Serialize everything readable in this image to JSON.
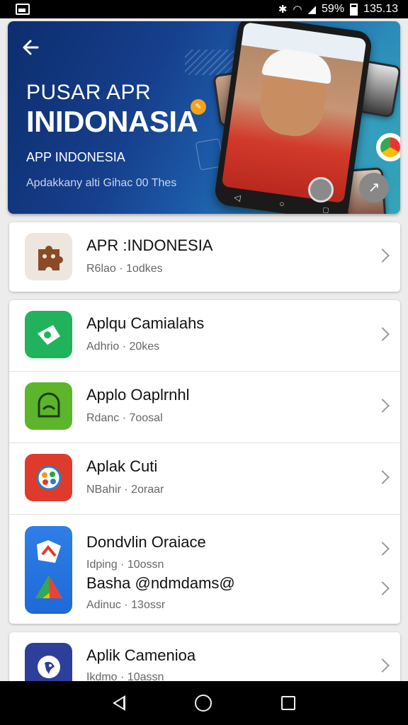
{
  "status_bar": {
    "battery": "59%",
    "time": "135.13"
  },
  "hero": {
    "title_line1": "PUSAR APR",
    "title_line2": "INIDONASIA",
    "subtitle": "APP INDONESIA",
    "caption": "Apdakkany alti Gihac 00 Thes"
  },
  "list": [
    {
      "title": "APR :INDONESIA",
      "subtitle": "R6lao · 1odkes",
      "icon": "puzzle-icon",
      "color": "#e8e2da"
    },
    {
      "title": "Aplqu Camialahs",
      "subtitle": "Adhrio · 20kes",
      "icon": "camera-app-icon",
      "color": "#22b35a"
    },
    {
      "title": "Applo Oaplrnhl",
      "subtitle": "Rdanc · 7oosal",
      "icon": "creature-app-icon",
      "color": "#59b52a"
    },
    {
      "title": "Aplak Cuti",
      "subtitle": "NBahir · 2oraar",
      "icon": "flower-app-icon",
      "color": "#e03a2d"
    },
    {
      "title": "Dondvlin Oraiace",
      "subtitle": "Idping · 10ossn",
      "icon": "maps-icon",
      "color": "#2f7ee6"
    },
    {
      "title": "Basha @ndmdams@",
      "subtitle": "Adinuc · 13ossr",
      "icon": "drive-icon",
      "color": "#1e6ad8"
    },
    {
      "title": "Aplik Camenioa",
      "subtitle": "Ikdmo · 10assn",
      "icon": "bird-app-icon",
      "color": "#2d3f9a"
    }
  ]
}
